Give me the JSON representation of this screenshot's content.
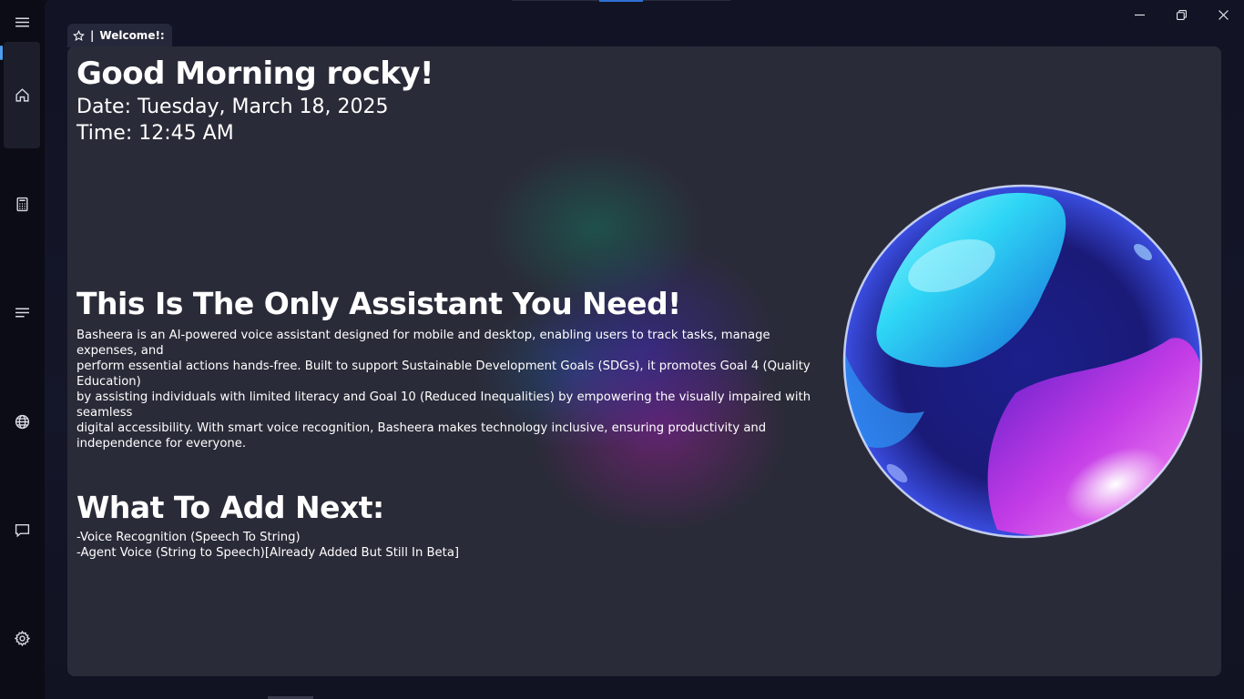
{
  "nav": {
    "items": [
      {
        "icon": "menu-icon"
      },
      {
        "icon": "home-icon",
        "active": true
      },
      {
        "icon": "calculator-icon"
      },
      {
        "icon": "list-icon"
      },
      {
        "icon": "globe-icon"
      },
      {
        "icon": "chat-icon"
      },
      {
        "icon": "settings-icon"
      }
    ]
  },
  "tab": {
    "label": "Welcome!:",
    "separator": "|",
    "icon": "star-icon"
  },
  "window_controls": {
    "icons": [
      "minimize-icon",
      "restore-icon",
      "close-icon"
    ]
  },
  "main": {
    "greeting": "Good Morning rocky!",
    "date": "Date: Tuesday, March 18, 2025",
    "time": "Time: 12:45 AM",
    "tagline": "This Is The Only Assistant You Need!",
    "description_lines": [
      "Basheera is an AI-powered voice assistant designed for mobile and desktop, enabling users to track tasks, manage expenses, and",
      "perform essential actions hands-free. Built to support Sustainable Development Goals (SDGs), it promotes Goal 4 (Quality Education)",
      "by assisting individuals with limited literacy and Goal 10 (Reduced Inequalities) by empowering the visually impaired with seamless",
      "digital accessibility. With smart voice recognition, Basheera makes technology inclusive, ensuring productivity and",
      "independence for everyone."
    ],
    "next_heading": "What To Add Next:",
    "next_items": [
      "-Voice Recognition (Speech To String)",
      "-Agent Voice (String to Speech)[Already Added But Still In Beta]"
    ]
  },
  "colors": {
    "accent": "#4c9ff0",
    "background": "#0c0e1a",
    "card": "#2a2b38"
  }
}
